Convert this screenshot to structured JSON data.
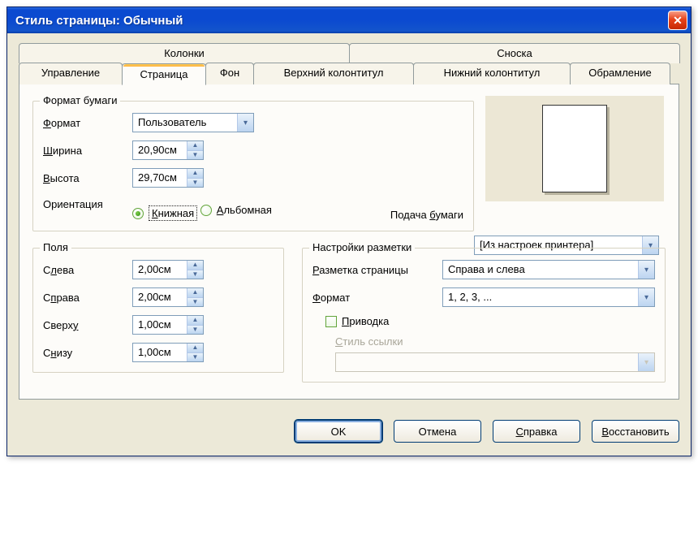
{
  "window": {
    "title": "Стиль страницы: Обычный"
  },
  "tabs": {
    "top": [
      "Колонки",
      "Сноска"
    ],
    "bottom": [
      "Управление",
      "Страница",
      "Фон",
      "Верхний колонтитул",
      "Нижний колонтитул",
      "Обрамление"
    ],
    "active": "Страница"
  },
  "paper": {
    "legend": "Формат бумаги",
    "format_label": "Формат",
    "format_value": "Пользователь",
    "width_label": "Ширина",
    "width_value": "20,90см",
    "height_label": "Высота",
    "height_value": "29,70см",
    "orient_label": "Ориентация",
    "orient_portrait": "Книжная",
    "orient_landscape": "Альбомная",
    "orient_selected": "portrait"
  },
  "feed": {
    "label": "Подача бумаги",
    "value": "[Из настроек принтера]"
  },
  "margins": {
    "legend": "Поля",
    "left_label": "Слева",
    "left_value": "2,00см",
    "right_label": "Справа",
    "right_value": "2,00см",
    "top_label": "Сверху",
    "top_value": "1,00см",
    "bottom_label": "Снизу",
    "bottom_value": "1,00см"
  },
  "layout": {
    "legend": "Настройки разметки",
    "pagelayout_label": "Разметка страницы",
    "pagelayout_value": "Справа и слева",
    "format_label": "Формат",
    "format_value": "1, 2, 3, ...",
    "register_label": "Приводка",
    "register_checked": false,
    "refstyle_label": "Стиль ссылки",
    "refstyle_value": ""
  },
  "buttons": {
    "ok": "OK",
    "cancel": "Отмена",
    "help": "Справка",
    "reset": "Восстановить"
  },
  "underline_chars": {
    "format": "Ф",
    "width": "Ш",
    "height": "В",
    "portrait": "К",
    "landscape": "А",
    "feed": "б",
    "margins_left": "л",
    "margins_right": "п",
    "margins_top": "у",
    "margins_bottom": "н",
    "pagelayout": "Р",
    "numformat": "Ф",
    "register": "П",
    "refstyle": "С",
    "help": "С",
    "reset": "В"
  }
}
